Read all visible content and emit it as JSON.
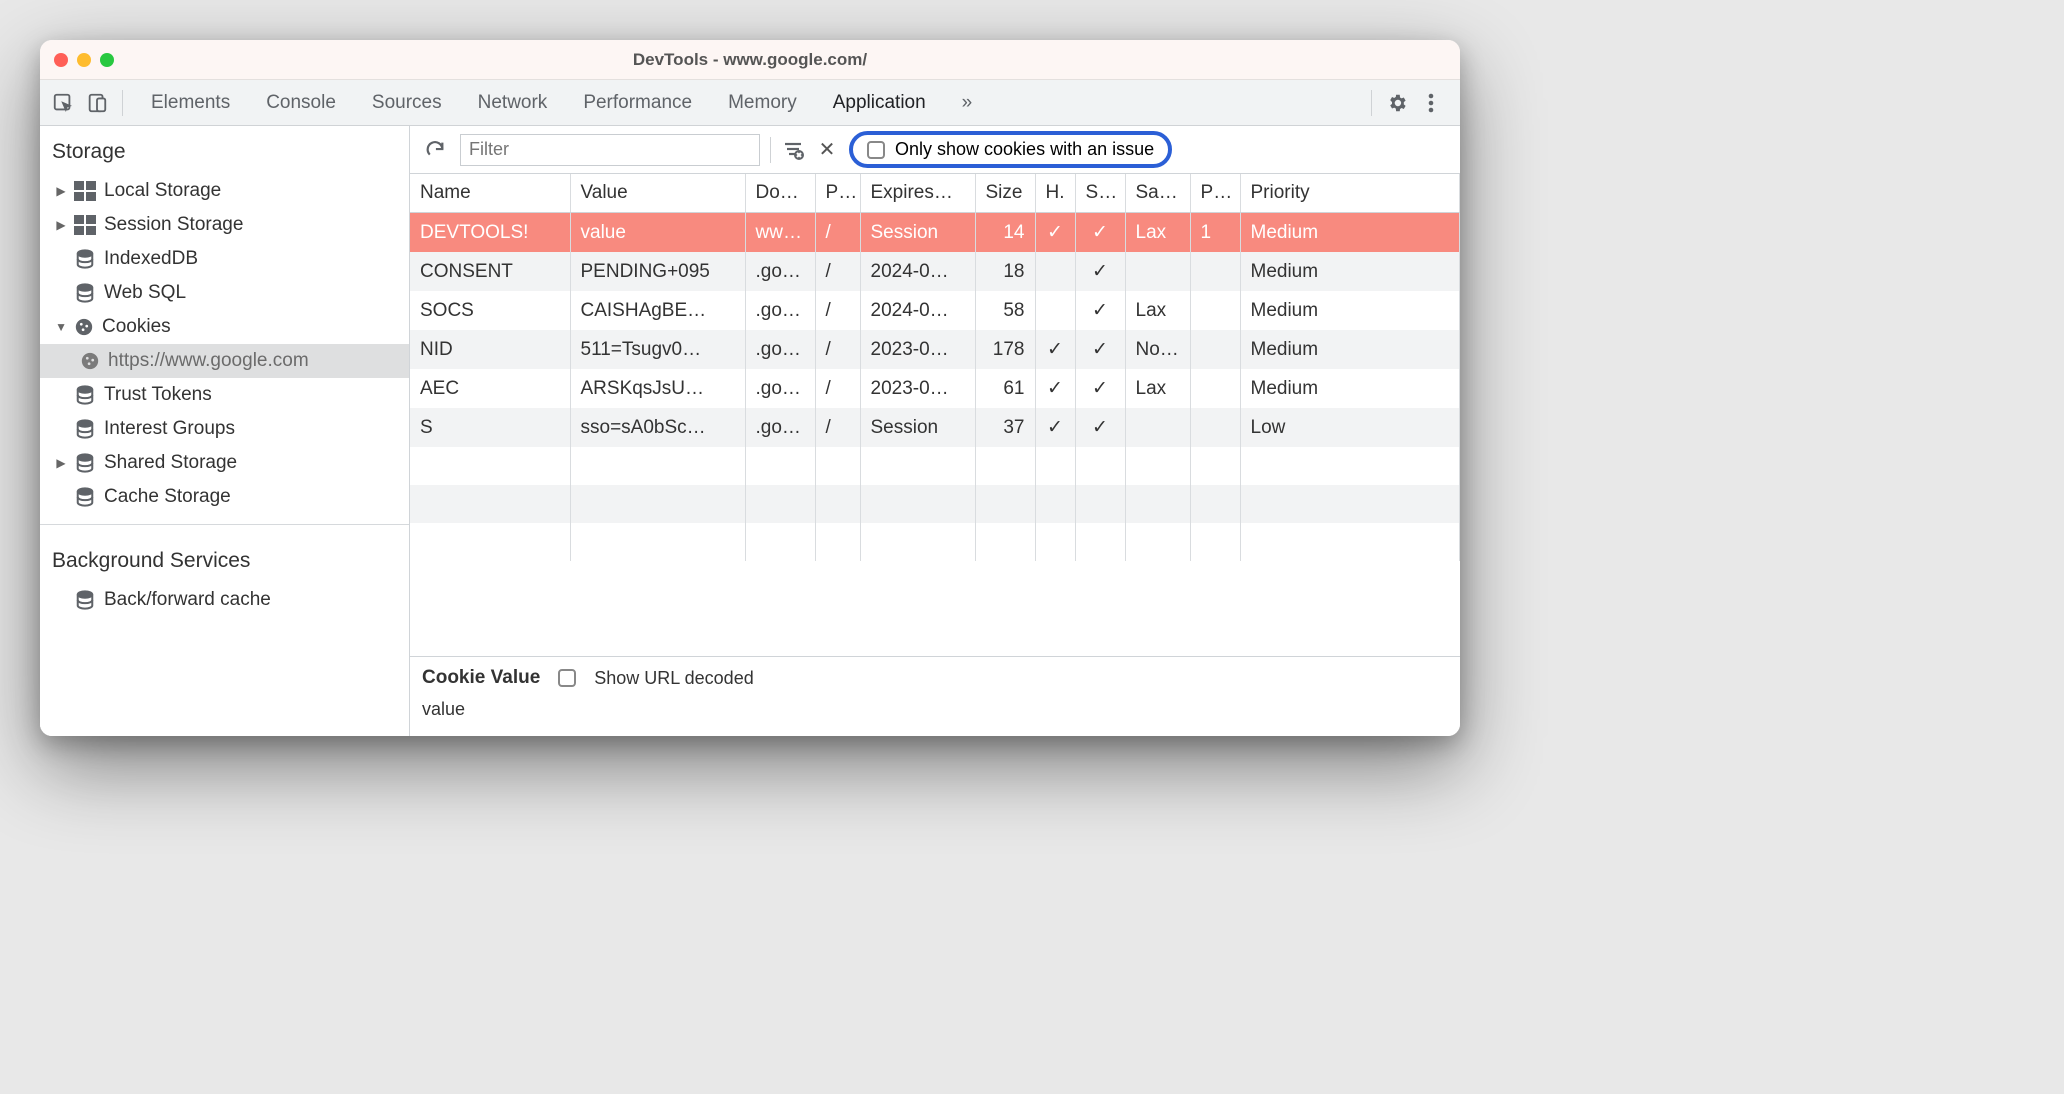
{
  "window": {
    "title": "DevTools - www.google.com/"
  },
  "tabs": {
    "items": [
      "Elements",
      "Console",
      "Sources",
      "Network",
      "Performance",
      "Memory",
      "Application"
    ],
    "active": "Application",
    "overflow": "»"
  },
  "filterbar": {
    "placeholder": "Filter",
    "issue_label": "Only show cookies with an issue"
  },
  "sidebar": {
    "storage_heading": "Storage",
    "items": {
      "local_storage": "Local Storage",
      "session_storage": "Session Storage",
      "indexeddb": "IndexedDB",
      "websql": "Web SQL",
      "cookies": "Cookies",
      "cookies_origin": "https://www.google.com",
      "trust_tokens": "Trust Tokens",
      "interest_groups": "Interest Groups",
      "shared_storage": "Shared Storage",
      "cache_storage": "Cache Storage"
    },
    "bg_heading": "Background Services",
    "bg_items": {
      "bfcache": "Back/forward cache"
    }
  },
  "columns": {
    "name": "Name",
    "value": "Value",
    "domain": "Do…",
    "path": "P…",
    "expires": "Expires…",
    "size": "Size",
    "http": "H.",
    "secure": "S…",
    "samesite": "Sa…",
    "party": "P…",
    "priority": "Priority"
  },
  "rows": [
    {
      "name": "DEVTOOLS!",
      "value": "value",
      "domain": "ww…",
      "path": "/",
      "expires": "Session",
      "size": "14",
      "http": "✓",
      "secure": "✓",
      "samesite": "Lax",
      "party": "1",
      "priority": "Medium",
      "hl": true
    },
    {
      "name": "CONSENT",
      "value": "PENDING+095",
      "domain": ".go…",
      "path": "/",
      "expires": "2024-0…",
      "size": "18",
      "http": "",
      "secure": "✓",
      "samesite": "",
      "party": "",
      "priority": "Medium"
    },
    {
      "name": "SOCS",
      "value": "CAISHAgBE…",
      "domain": ".go…",
      "path": "/",
      "expires": "2024-0…",
      "size": "58",
      "http": "",
      "secure": "✓",
      "samesite": "Lax",
      "party": "",
      "priority": "Medium"
    },
    {
      "name": "NID",
      "value": "511=Tsugv0…",
      "domain": ".go…",
      "path": "/",
      "expires": "2023-0…",
      "size": "178",
      "http": "✓",
      "secure": "✓",
      "samesite": "No…",
      "party": "",
      "priority": "Medium"
    },
    {
      "name": "AEC",
      "value": "ARSKqsJsU…",
      "domain": ".go…",
      "path": "/",
      "expires": "2023-0…",
      "size": "61",
      "http": "✓",
      "secure": "✓",
      "samesite": "Lax",
      "party": "",
      "priority": "Medium"
    },
    {
      "name": "S",
      "value": "sso=sA0bSc…",
      "domain": ".go…",
      "path": "/",
      "expires": "Session",
      "size": "37",
      "http": "✓",
      "secure": "✓",
      "samesite": "",
      "party": "",
      "priority": "Low"
    }
  ],
  "cookie_value": {
    "heading": "Cookie Value",
    "decoded_label": "Show URL decoded",
    "value": "value"
  }
}
